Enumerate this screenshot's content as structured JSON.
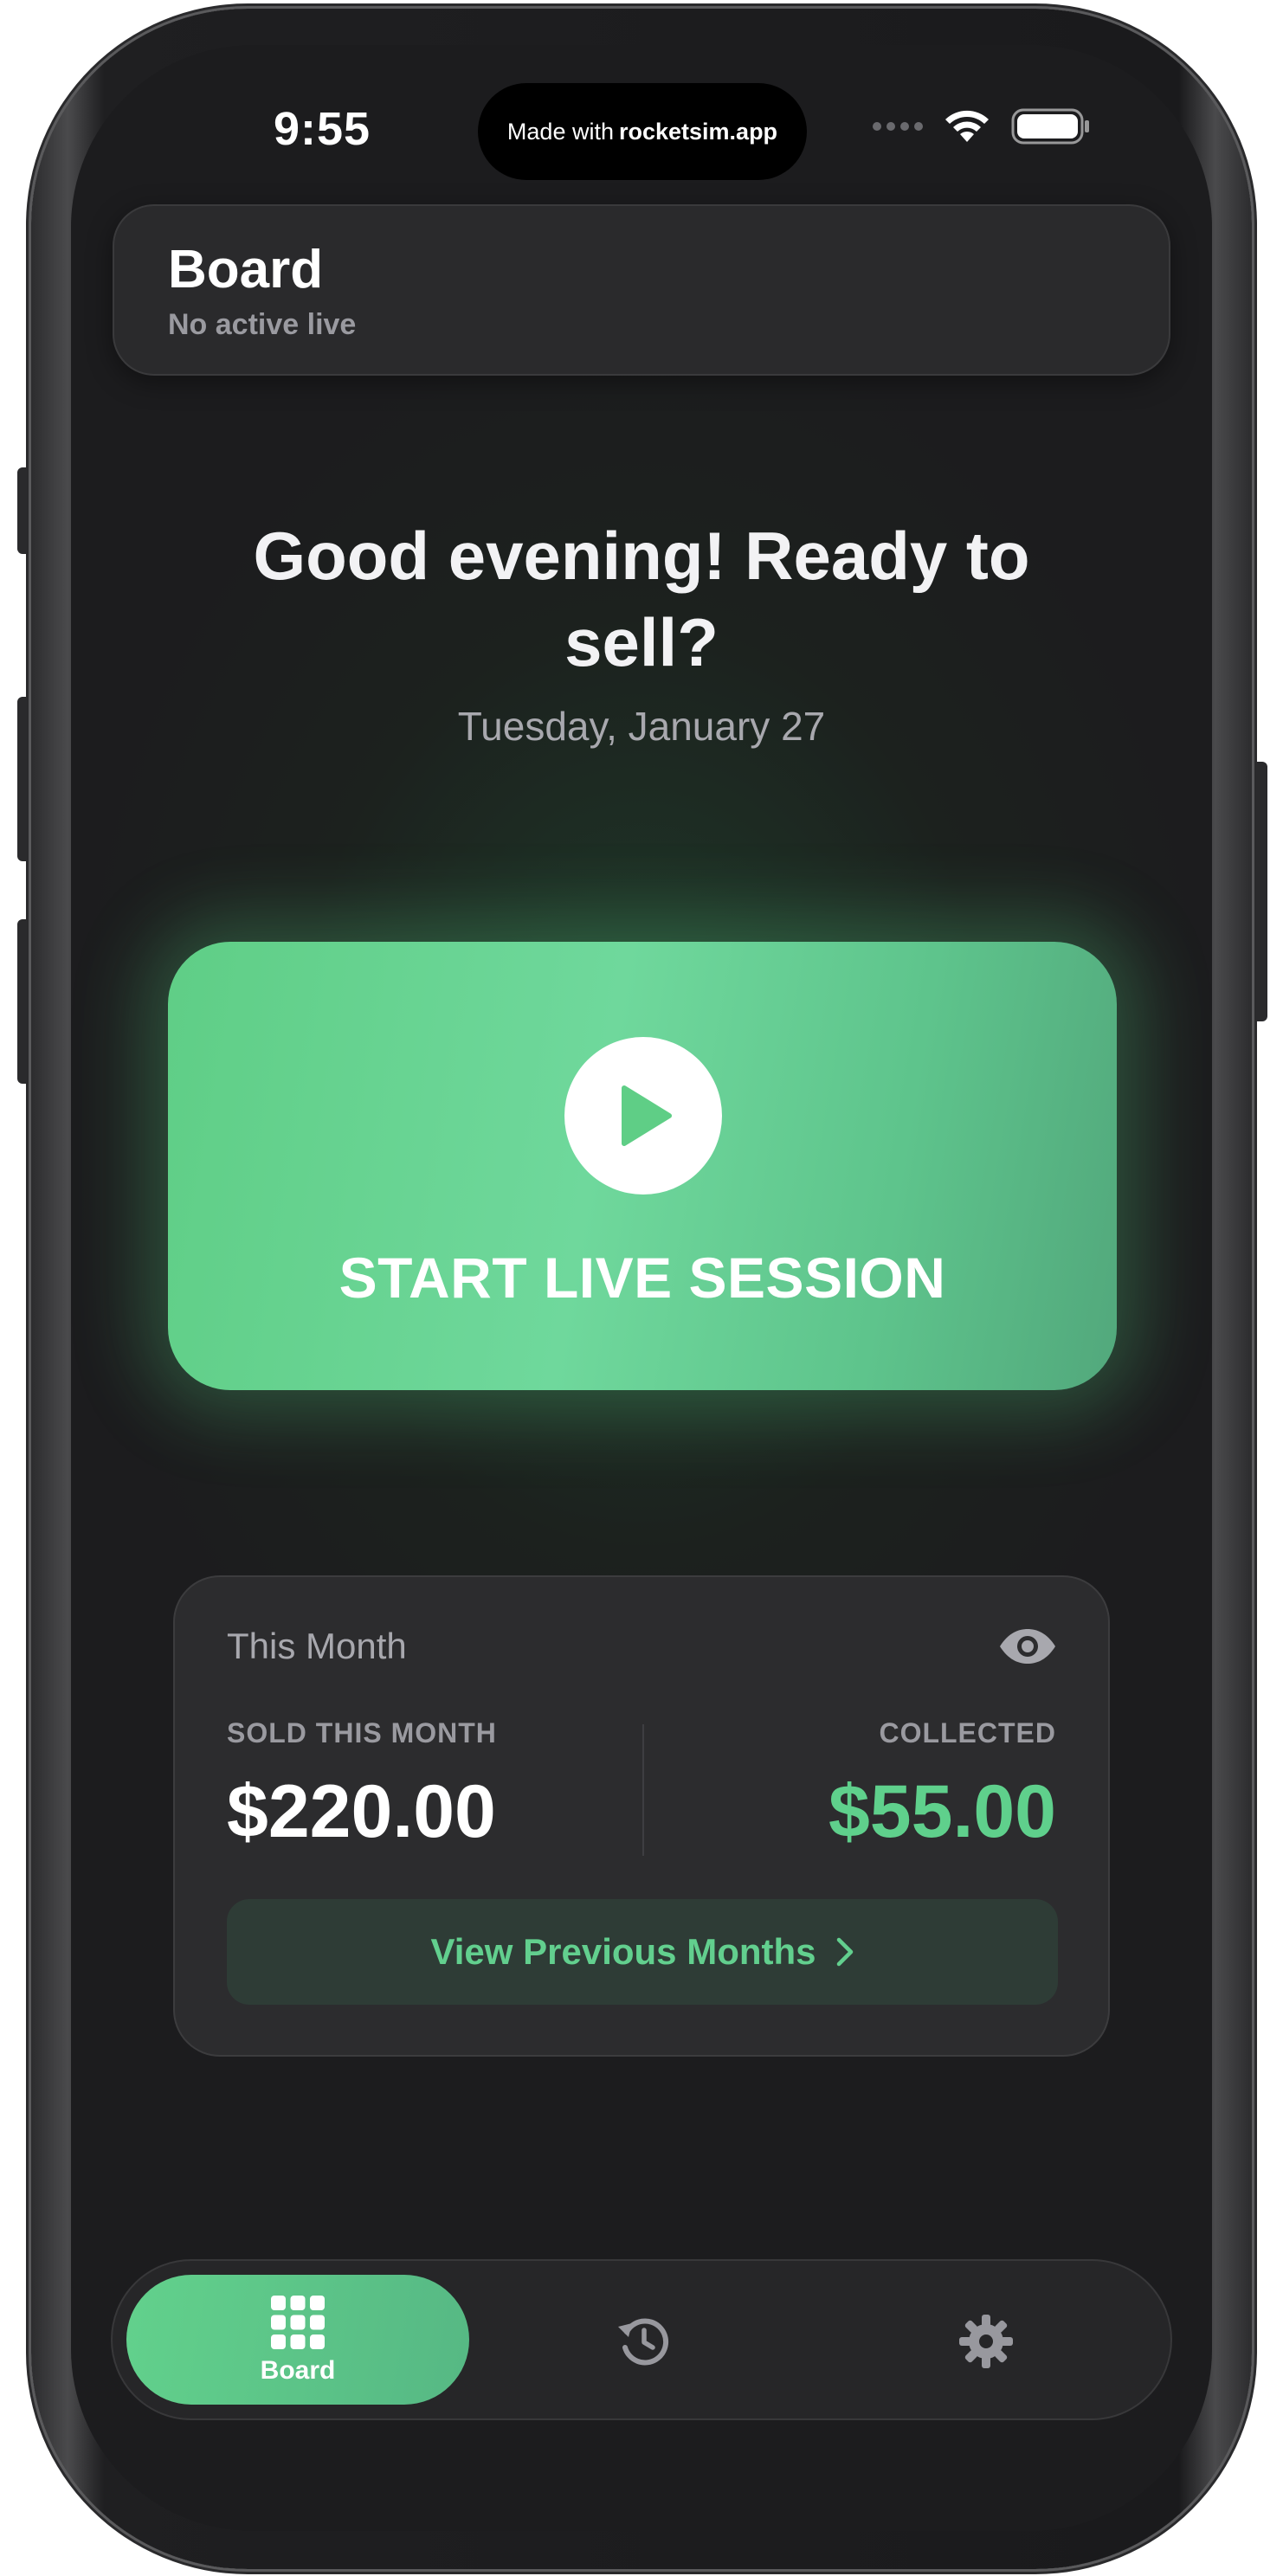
{
  "status_bar": {
    "time": "9:55",
    "island_prefix": "Made with",
    "island_brand": "rocketsim.app"
  },
  "header": {
    "title": "Board",
    "subtitle": "No active live"
  },
  "greeting": {
    "headline": "Good evening! Ready to sell?",
    "date": "Tuesday, January 27"
  },
  "live_button": {
    "label": "START LIVE SESSION",
    "icon": "play-icon"
  },
  "month_card": {
    "title": "This Month",
    "visibility_icon": "eye-icon",
    "sold_label": "SOLD THIS MONTH",
    "sold_value": "$220.00",
    "collected_label": "COLLECTED",
    "collected_value": "$55.00",
    "previous_button": "View Previous Months"
  },
  "tabbar": {
    "tabs": [
      {
        "label": "Board",
        "icon": "grid-icon",
        "active": true
      },
      {
        "label": "",
        "icon": "history-icon",
        "active": false
      },
      {
        "label": "",
        "icon": "gear-icon",
        "active": false
      }
    ]
  },
  "colors": {
    "accent_green": "#5fd08c",
    "background": "#1c1c1e",
    "card": "#2c2c2e"
  }
}
